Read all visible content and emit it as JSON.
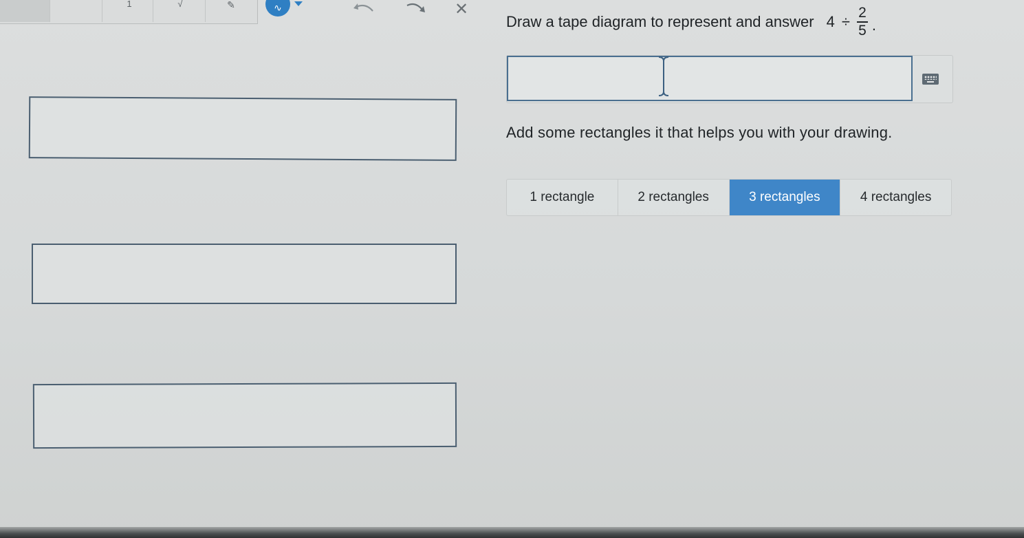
{
  "toolbar": {
    "tools": [
      {
        "name": "tool-1",
        "glyph": "1"
      },
      {
        "name": "sqrt",
        "glyph": "√"
      },
      {
        "name": "pen",
        "glyph": "✎"
      }
    ],
    "undo_icon": "undo-icon",
    "redo_icon": "redo-icon",
    "clear_icon": "close-icon",
    "clear_glyph": "✕",
    "pen_glyph": "∿",
    "accent_color": "#2f7fc3"
  },
  "question": {
    "prefix": "Draw a tape diagram to represent and answer",
    "dividend": "4",
    "operator": "÷",
    "numerator": "2",
    "denominator": "5",
    "suffix": "."
  },
  "answer": {
    "value": "",
    "placeholder": ""
  },
  "hint": {
    "text": "Add some rectangles it that helps you with your drawing."
  },
  "rect_choices": {
    "options": [
      {
        "label": "1 rectangle",
        "selected": false
      },
      {
        "label": "2 rectangles",
        "selected": false
      },
      {
        "label": "3 rectangles",
        "selected": true
      },
      {
        "label": "4 rectangles",
        "selected": false
      }
    ],
    "selected_color": "#3f86c8"
  },
  "canvas": {
    "rectangle_count": 3
  }
}
